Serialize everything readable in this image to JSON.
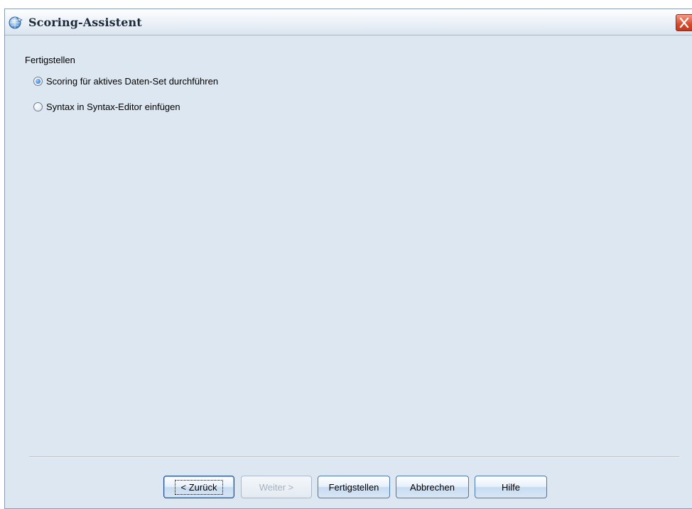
{
  "window": {
    "title": "Scoring-Assistent"
  },
  "content": {
    "section_label": "Fertigstellen",
    "options": [
      {
        "label": "Scoring für aktives Daten-Set durchführen",
        "checked": true
      },
      {
        "label": "Syntax in Syntax-Editor einfügen",
        "checked": false
      }
    ]
  },
  "buttons": {
    "back": "< Zurück",
    "next": "Weiter >",
    "finish": "Fertigstellen",
    "cancel": "Abbrechen",
    "help": "Hilfe"
  },
  "icons": {
    "app": "globe-arrow-icon",
    "close": "close-icon"
  },
  "colors": {
    "background": "#dde7f1",
    "close_button": "#d64a2c",
    "button_border": "#4a78ad"
  }
}
